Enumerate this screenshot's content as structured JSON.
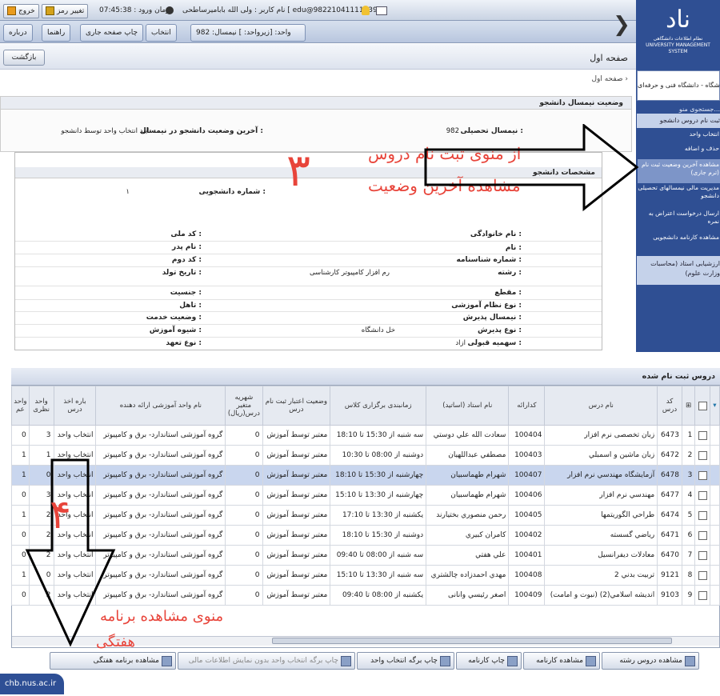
{
  "topbar": {
    "user": "نام کاربر : ولی الله باباميرساطحی [ edu@98221041111039 ]",
    "login_time": "زمان ورود : 07:45:38",
    "change_pass": "تغییر رمز",
    "exit": "خروج"
  },
  "subbar": {
    "unit": "واحد: [زیرواحد: ] نیمسال: 982",
    "select": "انتخاب",
    "print": "چاپ صفحه جاری",
    "help": "راهنما",
    "about": "درباره"
  },
  "page": {
    "title": "صفحه اول",
    "back": "بازگشت",
    "breadcrumb": "صفحه اول  ›"
  },
  "sidebar": {
    "logo_big": "ناد",
    "logo_line1": "نظام اطلاعات دانشگاهی",
    "logo_line2": "UNIVERSITY MANAGEMENT SYSTEM",
    "university": "دانشگاه - دانشگاه فنی و حرفه‌ای",
    "search": "جستجوی منو...",
    "menu_head": "ثبت نام دروس دانشجو",
    "items": [
      "انتخاب واحد",
      "حذف و اضافه",
      "مشاهده آخرین وضعیت ثبت نام (ترم جاری)",
      "مدیریت مالی نیمسالهای تحصیلی دانشجو",
      "ارسال درخواست اعتراض به نمره",
      "مشاهده کارنامه دانشجویی"
    ],
    "eval": "ارزشیابی استاد (محاسبات وزارت علوم)"
  },
  "status": {
    "header": "وضعیت نیمسال دانشجو",
    "term_label": "نیمسال تحصیلی :",
    "term_value": "982",
    "state_label": "آخرین وضعیت دانشجو در نیمسال :",
    "state_value": "تایید انتخاب واحد توسط دانشجو"
  },
  "profile": {
    "header": "مشخصات دانشجو",
    "student_no_label": "شماره دانشجویی :",
    "student_no_value": "۱",
    "right_labels": [
      "نام خانوادگی :",
      "نام :",
      "شماره شناسنامه :",
      "رشته :",
      "مقطع :",
      "نوع نظام آموزشی :",
      "نیمسال پذیرش :",
      "نوع پذیرش :",
      "سهمیه قبولی :"
    ],
    "left_labels": [
      "کد ملی :",
      "نام پدر :",
      "کد دوم :",
      "تاریخ تولد :",
      "جنسیت :",
      "تاهل :",
      "وضعیت خدمت :",
      "شیوه آموزش :",
      "نوع تعهد :"
    ],
    "field_value": "رم افزار کامپیوتر کارشناسی",
    "admission_value": "خل دانشگاه",
    "quota_value": "ازاد"
  },
  "annotations": {
    "num3": "۳",
    "text_line1": "از منوی ثبت نام دروس",
    "text_line2": "مشاهده آخرین وضعیت",
    "num4": "۴",
    "bottom_line1": "منوی مشاهده برنامه",
    "bottom_line2": "هفتگی",
    "arrow_color": "#000000",
    "text_color": "#e8443a"
  },
  "courses": {
    "title": "دروس ثبت نام شده",
    "headers": [
      "",
      "",
      "کد درس",
      "نام درس",
      "کدارائه",
      "نام استاد (اساتید)",
      "زمانبندی برگزاری کلاس",
      "وضعیت اعتبار ثبت نام درس",
      "وضعیت اعتبار ثبت نام درس",
      "شهریه متغیر درس(ریال)",
      "نام واحد آموزشی ارائه دهنده",
      "باره اخذ درس",
      "واحد نظری",
      "واحد عم"
    ],
    "rows": [
      [
        "1",
        "6473",
        "زبان تخصصی نرم افزار",
        "100404",
        "سعادت الله علي دوستي",
        "سه شنبه از 15:30 تا 18:10",
        "معتبر توسط آموزش",
        "0",
        "گروه آموزشی استاندارد- برق و کامپیوتر",
        "انتخاب واحد",
        "3",
        "0"
      ],
      [
        "2",
        "6472",
        "زبان ماشین و اسمبلي",
        "100403",
        "مصطفي عبداللهیان",
        "دوشنبه از 08:00 تا 10:30",
        "معتبر توسط آموزش",
        "0",
        "گروه آموزشی استاندارد- برق و کامپیوتر",
        "انتخاب واحد",
        "1",
        "1"
      ],
      [
        "3",
        "6478",
        "آزمایشگاه مهندسي نرم افزار",
        "100407",
        "شهرام طهماسبيان",
        "چهارشنبه از 15:30 تا 18:10",
        "معتبر توسط آموزش",
        "0",
        "گروه آموزشی استاندارد- برق و کامپیوتر",
        "انتخاب واحد",
        "0",
        "1"
      ],
      [
        "4",
        "6477",
        "مهندسي نرم افزار",
        "100406",
        "شهرام طهماسبيان",
        "چهارشنبه از 13:30 تا 15:10",
        "معتبر توسط آموزش",
        "0",
        "گروه آموزشی استاندارد- برق و کامپیوتر",
        "انتخاب واحد",
        "3",
        "0"
      ],
      [
        "5",
        "6474",
        "طراحي الگوريتمها",
        "100405",
        "رحمن منصوري بختيارند",
        "یکشنبه از 13:30 تا 17:10",
        "معتبر توسط آموزش",
        "0",
        "گروه آموزشی استاندارد- برق و کامپیوتر",
        "انتخاب واحد",
        "2",
        "1"
      ],
      [
        "6",
        "6471",
        "رياضي گسسته",
        "100402",
        "كامران كبيري",
        "دوشنبه از 15:30 تا 18:10",
        "معتبر توسط آموزش",
        "0",
        "گروه آموزشی استاندارد- برق و کامپیوتر",
        "انتخاب واحد",
        "2",
        "0"
      ],
      [
        "7",
        "6470",
        "معادلات ديفرانسيل",
        "100401",
        "علي هفتي",
        "سه شنبه از 08:00 تا 09:40",
        "معتبر توسط آموزش",
        "0",
        "گروه آموزشی استاندارد- برق و کامپیوتر",
        "انتخاب واحد",
        "2",
        "0"
      ],
      [
        "8",
        "9121",
        "تربيت بدني 2",
        "100408",
        "مهدي احمدزاده چالشتري",
        "سه شنبه از 13:30 تا 15:10",
        "معتبر توسط آموزش",
        "0",
        "گروه آموزشی استاندارد- برق و کامپیوتر",
        "انتخاب واحد",
        "0",
        "1"
      ],
      [
        "9",
        "9103",
        "انديشه اسلامي(2) (نبوت و امامت)",
        "100409",
        "اصغر رئيسي وانانی",
        "یکشنبه از 08:00 تا 09:40",
        "معتبر توسط آموزش",
        "0",
        "گروه آموزشی استاندارد- برق و کامپیوتر",
        "انتخاب واحد",
        "2",
        "0"
      ]
    ]
  },
  "bottom_buttons": [
    "مشاهده دروس رشته",
    "مشاهده کارنامه",
    "چاپ کارنامه",
    "چاپ برگه انتخاب واحد",
    "چاپ برگه انتخاب واحد بدون نمایش اطلاعات مالی",
    "مشاهده برنامه هفتگی"
  ],
  "watermark": "chb.nus.ac.ir"
}
